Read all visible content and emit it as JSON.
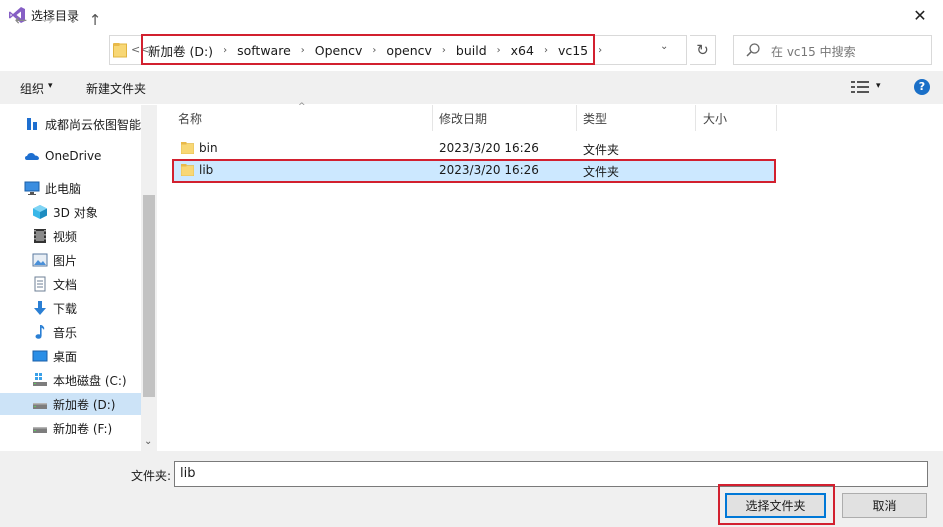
{
  "window": {
    "title": "选择目录",
    "close_glyph": "✕",
    "app_icon": "visual-studio-icon"
  },
  "nav": {
    "back": "←",
    "forward": "→",
    "recent": "⌄",
    "up": "↑"
  },
  "address": {
    "overflow": "<<",
    "crumbs": [
      "新加卷 (D:)",
      "software",
      "Opencv",
      "opencv",
      "build",
      "x64",
      "vc15"
    ],
    "separator": "›",
    "dropdown": "⌄",
    "refresh": "↻"
  },
  "search": {
    "placeholder": "在 vc15 中搜索"
  },
  "toolbar": {
    "organize": "组织",
    "organize_caret": "▾",
    "new_folder": "新建文件夹",
    "view_caret": "▾",
    "help": "?"
  },
  "sidebar": {
    "items": [
      {
        "label": "成都尚云依图智能",
        "icon": "cloud-drive-icon"
      },
      {
        "label": "OneDrive",
        "icon": "onedrive-icon"
      },
      {
        "label": "此电脑",
        "icon": "computer-icon"
      },
      {
        "label": "3D 对象",
        "icon": "3d-objects-icon"
      },
      {
        "label": "视频",
        "icon": "video-icon"
      },
      {
        "label": "图片",
        "icon": "pictures-icon"
      },
      {
        "label": "文档",
        "icon": "documents-icon"
      },
      {
        "label": "下载",
        "icon": "download-icon"
      },
      {
        "label": "音乐",
        "icon": "music-icon"
      },
      {
        "label": "桌面",
        "icon": "desktop-icon"
      },
      {
        "label": "本地磁盘 (C:)",
        "icon": "drive-c-icon"
      },
      {
        "label": "新加卷 (D:)",
        "icon": "drive-d-icon"
      },
      {
        "label": "新加卷 (F:)",
        "icon": "drive-f-icon"
      }
    ],
    "selected_index": 11
  },
  "columns": {
    "name": "名称",
    "date": "修改日期",
    "type": "类型",
    "size": "大小",
    "sort_caret": "^"
  },
  "files": [
    {
      "name": "bin",
      "date": "2023/3/20 16:26",
      "type": "文件夹",
      "selected": false
    },
    {
      "name": "lib",
      "date": "2023/3/20 16:26",
      "type": "文件夹",
      "selected": true
    }
  ],
  "footer": {
    "filename_label": "文件夹:",
    "filename_value": "lib",
    "select_button": "选择文件夹",
    "cancel_button": "取消"
  },
  "colors": {
    "accent": "#0078d7",
    "highlight": "#d2202f",
    "selection": "#cce8ff"
  }
}
